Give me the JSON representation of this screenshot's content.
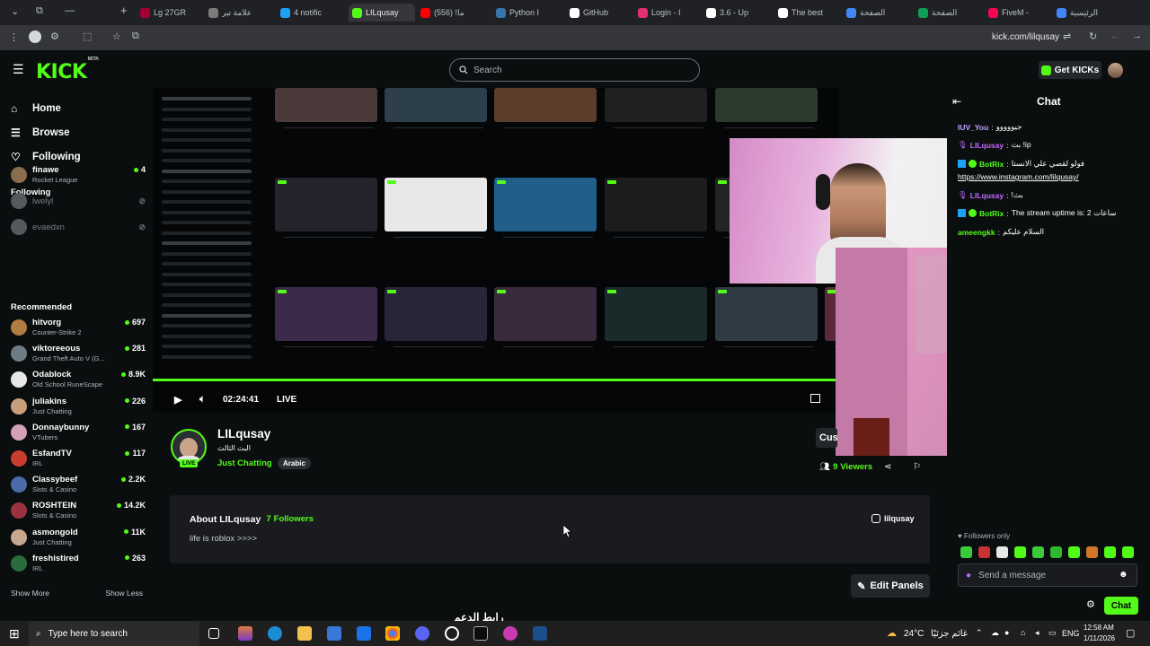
{
  "browser": {
    "tabs": [
      {
        "label": "Lg 27GR",
        "color": "#a50034"
      },
      {
        "label": "علامة تبر",
        "color": "#7b7b7b"
      },
      {
        "label": "4 notific",
        "color": "#1da1f2"
      },
      {
        "label": "LILqusay",
        "color": "#53fc18",
        "active": true
      },
      {
        "label": "(556) !ما",
        "color": "#ff0000"
      },
      {
        "label": "Python I",
        "color": "#3776ab"
      },
      {
        "label": "GitHub",
        "color": "#ffffff"
      },
      {
        "label": "Login - I",
        "color": "#e1306c"
      },
      {
        "label": "3.6 - Up",
        "color": "#ffffff"
      },
      {
        "label": "The best",
        "color": "#ffffff"
      },
      {
        "label": "الصفحة",
        "color": "#4285f4"
      },
      {
        "label": "الصفحة",
        "color": "#0f9d58"
      },
      {
        "label": "FiveM -",
        "color": "#f40552"
      },
      {
        "label": "الرئيسية",
        "color": "#4285f4"
      }
    ],
    "new_tab": "+",
    "url": "kick.com/lilqusay"
  },
  "topnav": {
    "logo": "KICK",
    "logo_badge": "BETA",
    "search_placeholder": "Search",
    "get_kicks": "Get KICKs"
  },
  "sidebar": {
    "nav": [
      {
        "label": "Home",
        "icon": "home-icon"
      },
      {
        "label": "Browse",
        "icon": "browse-icon"
      },
      {
        "label": "Following",
        "icon": "heart-icon"
      }
    ],
    "following_heading": "Following",
    "following": [
      {
        "name": "finawe",
        "category": "Rocket League",
        "viewers": "4",
        "live": true,
        "color": "#8a6d4e"
      },
      {
        "name": "lwelyl",
        "category": "",
        "viewers": "",
        "live": false,
        "color": "#55595d"
      },
      {
        "name": "evaedxn",
        "category": "",
        "viewers": "",
        "live": false,
        "color": "#55595d"
      }
    ],
    "recommended_heading": "Recommended",
    "recommended": [
      {
        "name": "hitvorg",
        "category": "Counter-Strike 2",
        "viewers": "697",
        "color": "#b07d42"
      },
      {
        "name": "viktoreeous",
        "category": "Grand Theft Auto V (G...",
        "viewers": "281",
        "color": "#6e7c86"
      },
      {
        "name": "Odablock",
        "category": "Old School RuneScape",
        "viewers": "8.9K",
        "color": "#e8e8e8"
      },
      {
        "name": "juliakins",
        "category": "Just Chatting",
        "viewers": "226",
        "color": "#c99e7a"
      },
      {
        "name": "Donnaybunny",
        "category": "VTubers",
        "viewers": "167",
        "color": "#d4a0b5"
      },
      {
        "name": "EsfandTV",
        "category": "IRL",
        "viewers": "117",
        "color": "#c83e2e"
      },
      {
        "name": "Classybeef",
        "category": "Slots & Casino",
        "viewers": "2.2K",
        "color": "#4a6aa8"
      },
      {
        "name": "ROSHTEIN",
        "category": "Slots & Casino",
        "viewers": "14.2K",
        "color": "#9a3340"
      },
      {
        "name": "asmongold",
        "category": "Just Chatting",
        "viewers": "11K",
        "color": "#c8a890"
      },
      {
        "name": "freshistired",
        "category": "IRL",
        "viewers": "263",
        "color": "#2b6c3c"
      }
    ],
    "show_more": "Show More",
    "show_less": "Show Less"
  },
  "player": {
    "time": "02:24:41",
    "live_label": "LIVE"
  },
  "streamer": {
    "name": "LILqusay",
    "title": "البث الثالث",
    "category": "Just Chatting",
    "tag": "Arabic",
    "live_badge": "LIVE",
    "viewers_count": "9",
    "viewers_label": "Viewers",
    "customize_label": "Cus"
  },
  "about": {
    "heading": "About LILqusay",
    "followers_count": "7",
    "followers_label": "Followers",
    "bio": "life is roblox >>>>",
    "instagram": "lilqusay"
  },
  "edit_panels": "Edit Panels",
  "chat": {
    "title": "Chat",
    "messages": [
      {
        "user": "IUV_You",
        "text": "جيووووو",
        "color": "#c0a4ff",
        "badges": false
      },
      {
        "user": "LILqusay",
        "text": "بث !ip",
        "color": "#c36aff",
        "badges": false
      },
      {
        "user": "BotRix",
        "text": "فولو لقصي علي الانستا",
        "color": "#53fc18",
        "badges": true
      },
      {
        "user": "",
        "text": "https://www.instagram.com/lilqusay/",
        "color": "#ffffff",
        "badges": false,
        "link": true
      },
      {
        "user": "LILqusay",
        "text": "!بث",
        "color": "#c36aff",
        "badges": false
      },
      {
        "user": "BotRix",
        "text": "The stream uptime is: 2 ساعات",
        "color": "#53fc18",
        "badges": true
      },
      {
        "user": "ameengkk",
        "text": "السلام عليكم",
        "color": "#53fc18",
        "badges": false
      }
    ],
    "followers_only": "Followers only",
    "input_placeholder": "Send a message",
    "send_button": "Chat"
  },
  "overlay_text": "رابط الدعم",
  "taskbar": {
    "search_placeholder": "Type here to search",
    "weather": "24°C",
    "weather_desc": "غائم جزئيًا",
    "language": "ENG",
    "time": "12:58 AM",
    "date": "1/11/2026"
  }
}
